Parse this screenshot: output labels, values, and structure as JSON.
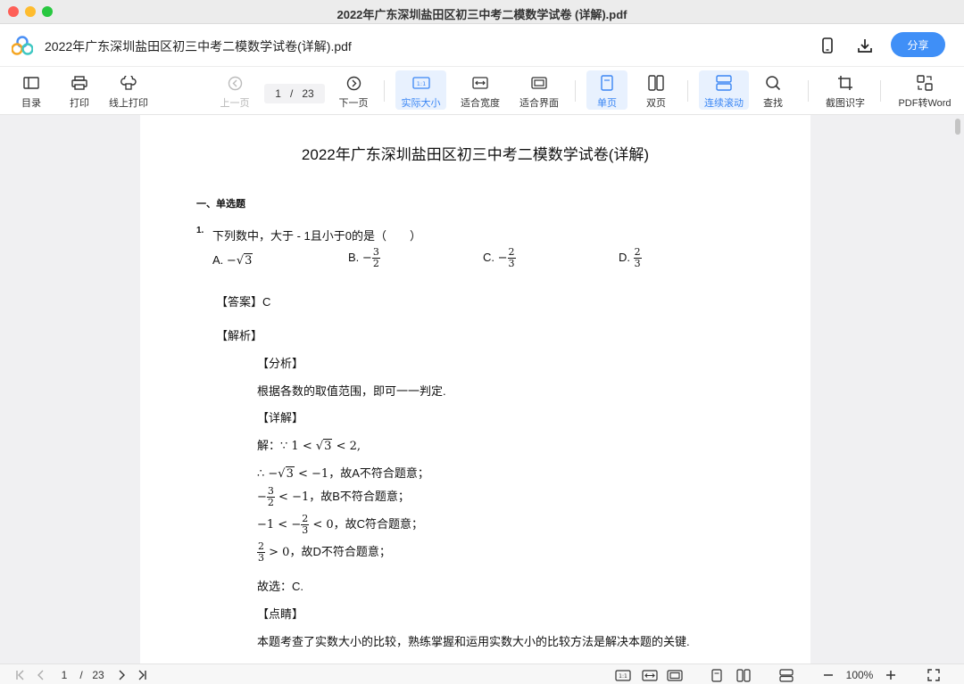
{
  "window": {
    "title": "2022年广东深圳盐田区初三中考二模数学试卷 (详解).pdf"
  },
  "appbar": {
    "doc_title": "2022年广东深圳盐田区初三中考二模数学试卷(详解).pdf",
    "share_label": "分享",
    "icons": [
      "app-logo",
      "phone-icon",
      "download-icon"
    ]
  },
  "toolbar": {
    "toc": "目录",
    "print": "打印",
    "online_print": "线上打印",
    "prev": "上一页",
    "page_current": "1",
    "page_sep": "/",
    "page_total": "23",
    "next": "下一页",
    "actual_size": "实际大小",
    "fit_width": "适合宽度",
    "fit_page": "适合界面",
    "single": "单页",
    "double": "双页",
    "continuous": "连续滚动",
    "find": "查找",
    "ocr": "截图识字",
    "to_word": "PDF转Word",
    "actual_icon_text": "1:1",
    "accent": "#3a86f4"
  },
  "doc": {
    "title": "2022年广东深圳盐田区初三中考二模数学试卷(详解)",
    "section": "一、单选题",
    "q_num": "1.",
    "question": "下列数中，大于 - 1且小于0的是（　　）",
    "opt_a_label": "A.",
    "opt_b_label": "B.",
    "opt_c_label": "C.",
    "opt_d_label": "D.",
    "answer": "【答案】C",
    "analysis": "【解析】",
    "fenxi": "【分析】",
    "fenxi_text": "根据各数的取值范围，即可一一判定.",
    "xiangjie": "【详解】",
    "step1_pre": "解：",
    "step2_tail": "，故A不符合题意；",
    "step3_tail": "，故B不符合题意；",
    "step4_tail": "，故C符合题意；",
    "step5_tail": "，故D不符合题意；",
    "choose": "故选：C.",
    "dianjing": "【点睛】",
    "summary": "本题考查了实数大小的比较，熟练掌握和运用实数大小的比较方法是解决本题的关键."
  },
  "statusbar": {
    "page_current": "1",
    "page_sep": "/",
    "page_total": "23",
    "zoom": "100%",
    "ratio_icon": "1:1"
  }
}
